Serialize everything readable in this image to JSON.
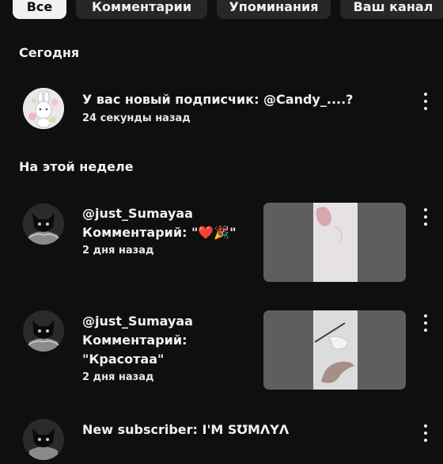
{
  "chips": [
    "Все",
    "Комментарии",
    "Упоминания",
    "Ваш канал"
  ],
  "sections": {
    "today": "Сегодня",
    "this_week": "На этой неделе"
  },
  "notifications": [
    {
      "main": "У вас новый подписчик: @Candy_....?",
      "time": "24 секунды назад"
    },
    {
      "user": "@just_Sumayaa",
      "comment": "Комментарий: \"❤️🎉\"",
      "time": "2 дня назад"
    },
    {
      "user": "@just_Sumayaa",
      "comment_line1": "Комментарий:",
      "comment_line2": "\"Красотаа\"",
      "time": "2 дня назад"
    },
    {
      "main": "New subscriber: I'M SƱMΛYΛ"
    }
  ],
  "colors": {
    "background": "#0f0f0f",
    "chip": "#272727",
    "chip_active": "#f1f1f1",
    "thumbnail": "#5e5e5e"
  },
  "icons": [
    "more-vert-icon",
    "avatar-bunny",
    "avatar-cat"
  ]
}
